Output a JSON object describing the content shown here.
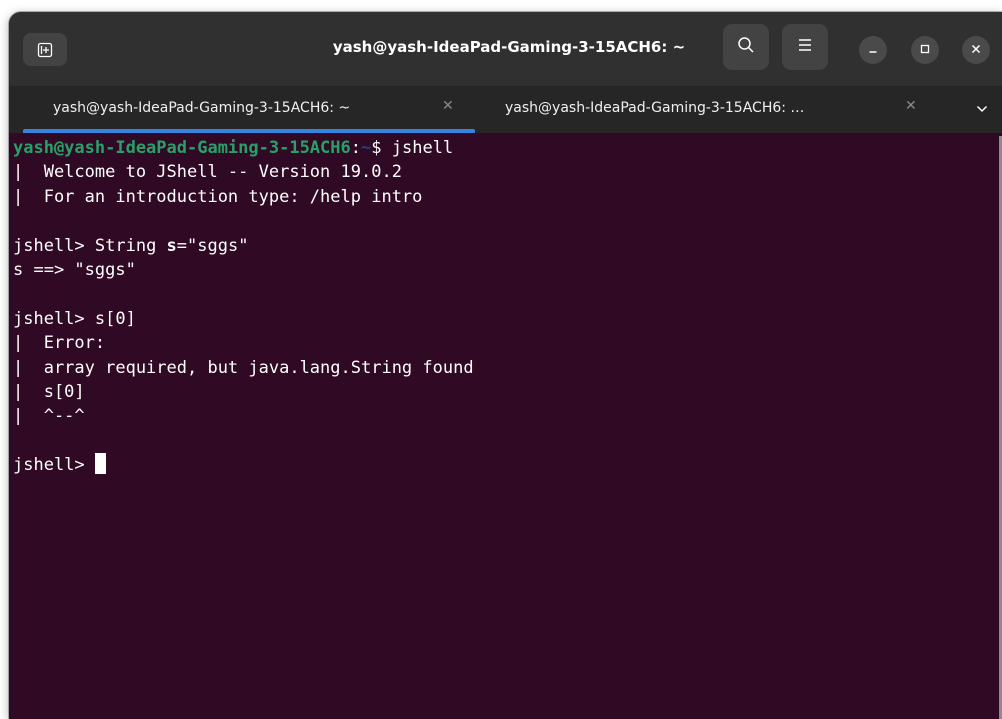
{
  "window": {
    "title": "yash@yash-IdeaPad-Gaming-3-15ACH6: ~"
  },
  "header": {
    "new_tab_icon": "new-tab-icon",
    "search_icon": "search-icon",
    "menu_icon": "hamburger-menu-icon",
    "minimize_icon": "minimize-icon",
    "maximize_icon": "maximize-icon",
    "close_icon": "close-icon"
  },
  "tabs": [
    {
      "label": "yash@yash-IdeaPad-Gaming-3-15ACH6: ~",
      "close": "✕",
      "active": true
    },
    {
      "label": "yash@yash-IdeaPad-Gaming-3-15ACH6: …",
      "close": "✕",
      "active": false
    }
  ],
  "terminal": {
    "prompt_user": "yash@yash-IdeaPad-Gaming-3-15ACH6",
    "prompt_sep": ":",
    "prompt_path": "~",
    "prompt_end": "$ ",
    "command": "jshell",
    "welcome_line": "|  Welcome to JShell -- Version 19.0.2",
    "intro_line": "|  For an introduction type: /help intro",
    "jshell_prompt": "jshell> ",
    "input1_pre": "String ",
    "input1_var": "s",
    "input1_post": "=\"sggs\"",
    "output1": "s ==> \"sggs\"",
    "input2": "s[0]",
    "error_lines": [
      "|  Error:",
      "|  array required, but java.lang.String found",
      "|  s[0]",
      "|  ^--^"
    ]
  },
  "colors": {
    "terminal_bg": "#300a24",
    "prompt_user": "#26a269",
    "prompt_path": "#12488b",
    "tab_indicator": "#3584e4",
    "header_bg": "#303030",
    "tabbar_bg": "#262626"
  }
}
